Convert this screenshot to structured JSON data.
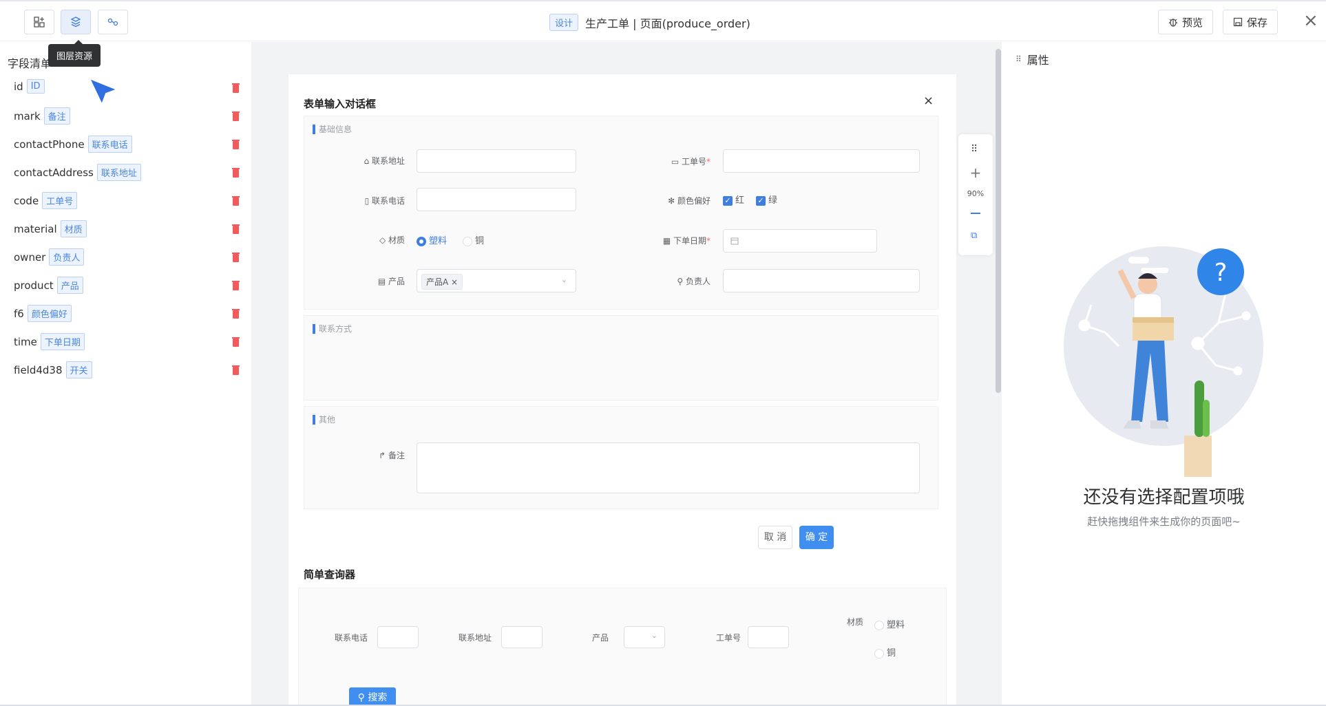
{
  "app": {
    "design_tag": "设计",
    "title": "生产工单 | 页面(produce_order)",
    "preview_label": "预览",
    "save_label": "保存",
    "tooltip": "图层资源"
  },
  "left": {
    "title": "字段清单",
    "fields": [
      {
        "name": "id",
        "tag": "ID"
      },
      {
        "name": "mark",
        "tag": "备注"
      },
      {
        "name": "contactPhone",
        "tag": "联系电话"
      },
      {
        "name": "contactAddress",
        "tag": "联系地址"
      },
      {
        "name": "code",
        "tag": "工单号"
      },
      {
        "name": "material",
        "tag": "材质"
      },
      {
        "name": "owner",
        "tag": "负责人"
      },
      {
        "name": "product",
        "tag": "产品"
      },
      {
        "name": "f6",
        "tag": "颜色偏好"
      },
      {
        "name": "time",
        "tag": "下单日期"
      },
      {
        "name": "field4d38",
        "tag": "开关"
      }
    ]
  },
  "dialog": {
    "title": "表单输入对话框",
    "close": "×",
    "sections": {
      "basic": "基础信息",
      "contact": "联系方式",
      "other": "其他"
    },
    "labels": {
      "address": "联系地址",
      "code": "工单号",
      "phone": "联系电话",
      "color": "颜色偏好",
      "material": "材质",
      "date": "下单日期",
      "product": "产品",
      "owner": "负责人",
      "remark": "备注"
    },
    "color_options": [
      "红",
      "绿"
    ],
    "material_options": [
      "塑料",
      "铜"
    ],
    "product_value": "产品A",
    "cancel": "取 消",
    "ok": "确 定"
  },
  "query": {
    "title": "简单查询器",
    "labels": {
      "phone": "联系电话",
      "address": "联系地址",
      "product": "产品",
      "code": "工单号",
      "material": "材质"
    },
    "material_options": [
      "塑料",
      "铜"
    ],
    "search": "搜索"
  },
  "zoom": {
    "level": "90%"
  },
  "right": {
    "title": "属性",
    "empty_title": "还没有选择配置项哦",
    "empty_sub": "赶快拖拽组件来生成你的页面吧~"
  },
  "colors": {
    "primary": "#3f8ef0",
    "danger": "#f25b5b",
    "canvas_bg": "#f2f3f5"
  }
}
